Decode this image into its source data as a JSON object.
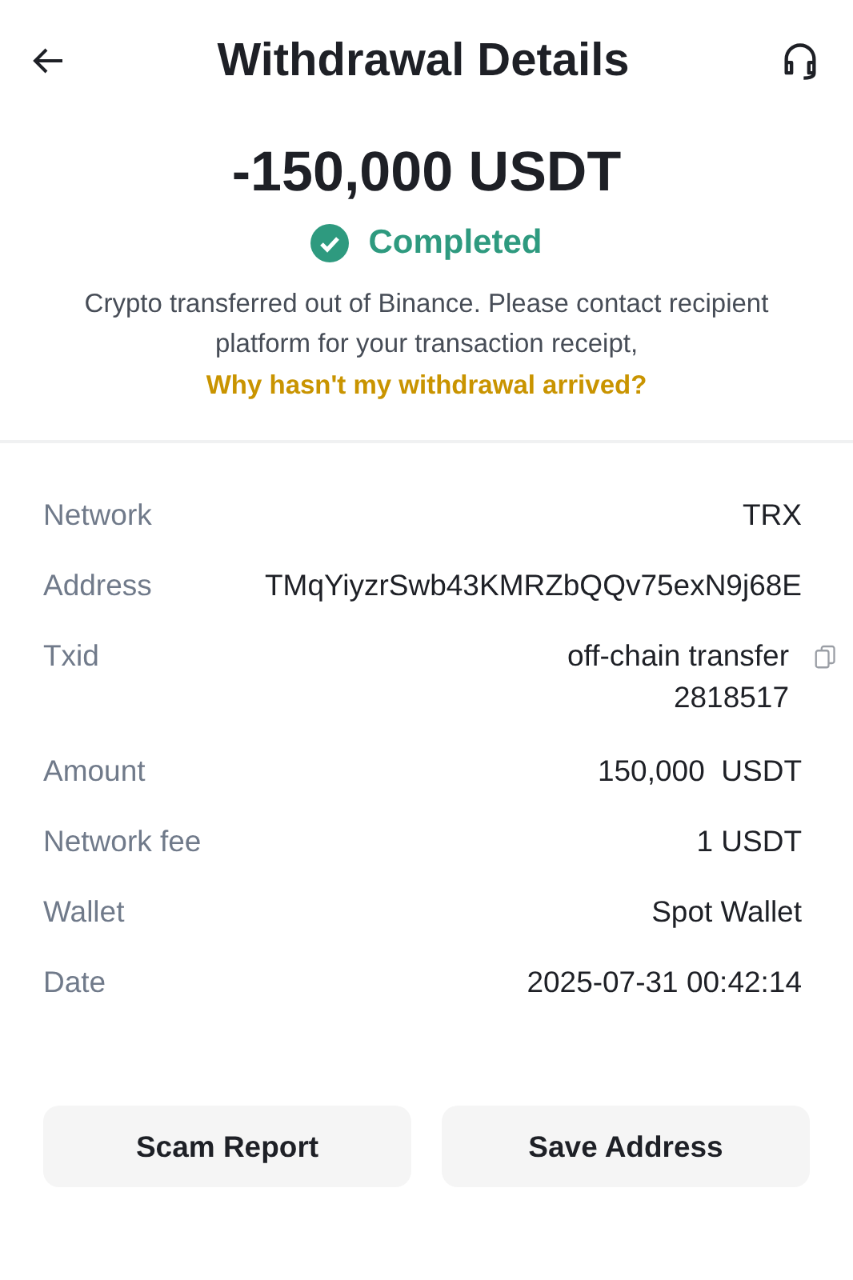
{
  "header": {
    "title": "Withdrawal Details"
  },
  "amount": "-150,000 USDT",
  "status": {
    "label": "Completed",
    "kind": "success"
  },
  "notice": {
    "text": "Crypto transferred out of Binance. Please contact recipient platform for your transaction receipt,",
    "link": "Why hasn't my withdrawal arrived?"
  },
  "details": [
    {
      "label": "Network",
      "value": "TRX",
      "kind": "text"
    },
    {
      "label": "Address",
      "value": "TMqYiyzrSwb43KMRZbQQv75exN9j68E",
      "kind": "text"
    },
    {
      "label": "Txid",
      "value": "off-chain transfer 2818517",
      "kind": "copy"
    },
    {
      "label": "Amount",
      "value": "150,000  USDT",
      "kind": "text"
    },
    {
      "label": "Network fee",
      "value": "1 USDT",
      "kind": "text"
    },
    {
      "label": "Wallet",
      "value": "Spot Wallet",
      "kind": "text"
    },
    {
      "label": "Date",
      "value": "2025-07-31 00:42:14",
      "kind": "text"
    }
  ],
  "buttons": [
    "Scam Report",
    "Save Address"
  ]
}
